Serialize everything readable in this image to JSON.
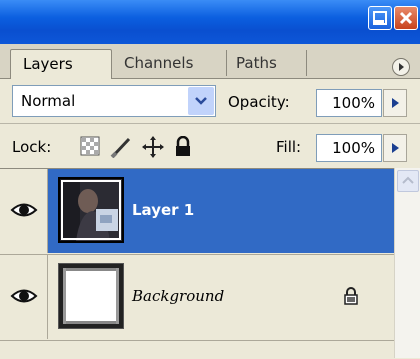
{
  "tabs": [
    {
      "label": "Layers",
      "active": true
    },
    {
      "label": "Channels",
      "active": false
    },
    {
      "label": "Paths",
      "active": false
    }
  ],
  "blend": {
    "mode": "Normal"
  },
  "opacity": {
    "label": "Opacity:",
    "value": "100%"
  },
  "lock": {
    "label": "Lock:",
    "icons": [
      "lock-transparent-icon",
      "lock-brush-icon",
      "lock-move-icon",
      "lock-all-icon"
    ]
  },
  "fill": {
    "label": "Fill:",
    "value": "100%"
  },
  "layers": [
    {
      "name": "Layer 1",
      "visible": true,
      "selected": true
    },
    {
      "name": "Background",
      "visible": true,
      "selected": false,
      "locked": true
    }
  ],
  "colors": {
    "titlebar": "#0b5fe0",
    "selection": "#316ac5",
    "panel": "#ece9d8"
  }
}
